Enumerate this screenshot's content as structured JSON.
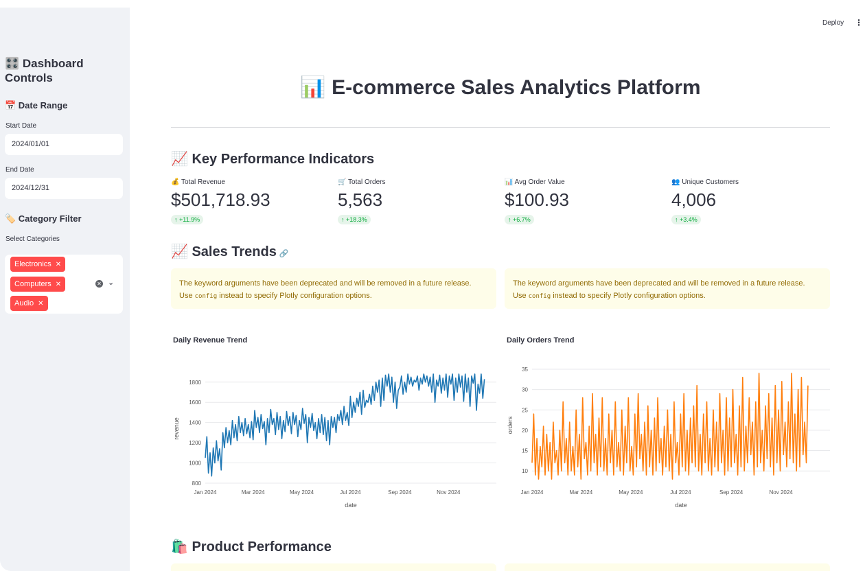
{
  "header": {
    "deploy_label": "Deploy",
    "menu_icon": "⋮"
  },
  "sidebar": {
    "title": "🎛️ Dashboard Controls",
    "date_range_heading": "📅 Date Range",
    "start_date_label": "Start Date",
    "start_date_value": "2024/01/01",
    "end_date_label": "End Date",
    "end_date_value": "2024/12/31",
    "category_heading": "🏷️ Category Filter",
    "categories_label": "Select Categories",
    "selected_categories": [
      "Electronics",
      "Computers",
      "Audio"
    ]
  },
  "main": {
    "title": "📊 E-commerce Sales Analytics Platform",
    "kpi_heading": "📈 Key Performance Indicators",
    "kpis": [
      {
        "label": "💰 Total Revenue",
        "value": "$501,718.93",
        "delta": "+11.9%"
      },
      {
        "label": "🛒 Total Orders",
        "value": "5,563",
        "delta": "+18.3%"
      },
      {
        "label": "📊 Avg Order Value",
        "value": "$100.93",
        "delta": "+6.7%"
      },
      {
        "label": "👥 Unique Customers",
        "value": "4,006",
        "delta": "+3.4%"
      }
    ],
    "sales_trends_heading": "📈 Sales Trends",
    "warning_line1": "The keyword arguments have been deprecated and will be removed in a future release.",
    "warning_use": "Use",
    "warning_code": "config",
    "warning_line2": "instead to specify Plotly configuration options.",
    "product_heading": "🛍️ Product Performance"
  },
  "chart_data": [
    {
      "type": "line",
      "title": "Daily Revenue Trend",
      "xlabel": "date",
      "ylabel": "revenue",
      "color": "#1f77b4",
      "ylim": [
        800,
        1880
      ],
      "yticks": [
        800,
        1000,
        1200,
        1400,
        1600,
        1800
      ],
      "xticks": [
        "Jan 2024",
        "Mar 2024",
        "May 2024",
        "Jul 2024",
        "Sep 2024",
        "Nov 2024"
      ],
      "x_range": [
        "2024-01-01",
        "2024-12-31"
      ],
      "series": [
        {
          "x_start": "2024-01-01",
          "x_step_days": 2,
          "values": [
            1050,
            1260,
            900,
            1100,
            870,
            1150,
            1000,
            1220,
            1020,
            1140,
            930,
            1300,
            1150,
            1350,
            1200,
            1320,
            1180,
            1420,
            1250,
            1380,
            1220,
            1460,
            1300,
            1400,
            1270,
            1440,
            1290,
            1380,
            1250,
            1410,
            1230,
            1520,
            1350,
            1450,
            1300,
            1480,
            1340,
            1410,
            1180,
            1440,
            1300,
            1530,
            1380,
            1440,
            1280,
            1500,
            1330,
            1460,
            1240,
            1420,
            1310,
            1510,
            1370,
            1460,
            1290,
            1500,
            1380,
            1470,
            1260,
            1420,
            1330,
            1540,
            1390,
            1480,
            1200,
            1450,
            1350,
            1490,
            1320,
            1400,
            1240,
            1440,
            1300,
            1480,
            1280,
            1450,
            1220,
            1420,
            1180,
            1460,
            1350,
            1450,
            1300,
            1480,
            1420,
            1520,
            1380,
            1560,
            1420,
            1500,
            1370,
            1660,
            1450,
            1600,
            1500,
            1640,
            1560,
            1700,
            1480,
            1720,
            1550,
            1620,
            1600,
            1680,
            1580,
            1760,
            1620,
            1800,
            1700,
            1820,
            1560,
            1840,
            1620,
            1870,
            1760,
            1880,
            1700,
            1850,
            1600,
            1800,
            1540,
            1720,
            1750,
            1860,
            1680,
            1800,
            1700,
            1880,
            1780,
            1850,
            1760,
            1820,
            1800,
            1860,
            1720,
            1840,
            1780,
            1880,
            1800,
            1860,
            1760,
            1850,
            1700,
            1880,
            1600,
            1820,
            1760,
            1870,
            1690,
            1840,
            1720,
            1880,
            1650,
            1860,
            1780,
            1880,
            1620,
            1840,
            1700,
            1880,
            1750,
            1860,
            1610,
            1880,
            1700,
            1840,
            1560,
            1860,
            1790,
            1880,
            1520,
            1780,
            1690,
            1880,
            1640,
            1830
          ]
        }
      ]
    },
    {
      "type": "line",
      "title": "Daily Orders Trend",
      "xlabel": "date",
      "ylabel": "orders",
      "color": "#ff7f0e",
      "ylim": [
        7,
        35.5
      ],
      "yticks": [
        10,
        15,
        20,
        25,
        30,
        35
      ],
      "xticks": [
        "Jan 2024",
        "Mar 2024",
        "May 2024",
        "Jul 2024",
        "Sep 2024",
        "Nov 2024"
      ],
      "x_range": [
        "2024-01-01",
        "2024-12-31"
      ],
      "series": [
        {
          "x_start": "2024-01-01",
          "x_step_days": 2,
          "values": [
            12,
            24,
            9,
            18,
            8,
            16,
            11,
            21,
            9,
            19,
            10,
            17,
            8,
            22,
            12,
            15,
            9,
            20,
            10,
            27,
            12,
            18,
            9,
            22,
            10,
            16,
            9,
            25,
            11,
            19,
            8,
            28,
            13,
            17,
            9,
            21,
            10,
            29,
            12,
            19,
            9,
            23,
            11,
            28,
            10,
            18,
            9,
            24,
            12,
            20,
            9,
            27,
            11,
            17,
            10,
            25,
            9,
            21,
            12,
            28,
            10,
            16,
            9,
            24,
            11,
            29,
            13,
            19,
            10,
            22,
            9,
            26,
            11,
            20,
            9,
            23,
            10,
            28,
            12,
            18,
            9,
            21,
            11,
            25,
            10,
            19,
            8,
            27,
            12,
            17,
            9,
            24,
            11,
            29,
            10,
            20,
            9,
            23,
            12,
            26,
            11,
            31,
            10,
            19,
            9,
            24,
            12,
            27,
            10,
            18,
            9,
            25,
            11,
            22,
            10,
            29,
            12,
            20,
            9,
            28,
            10,
            23,
            11,
            30,
            12,
            19,
            9,
            26,
            11,
            33,
            10,
            21,
            12,
            28,
            14,
            22,
            9,
            27,
            11,
            34,
            12,
            20,
            10,
            26,
            13,
            29,
            11,
            23,
            9,
            31,
            12,
            25,
            10,
            32,
            14,
            22,
            11,
            27,
            13,
            34,
            12,
            24,
            10,
            30,
            11,
            33,
            14,
            22,
            12,
            31
          ]
        }
      ]
    }
  ]
}
